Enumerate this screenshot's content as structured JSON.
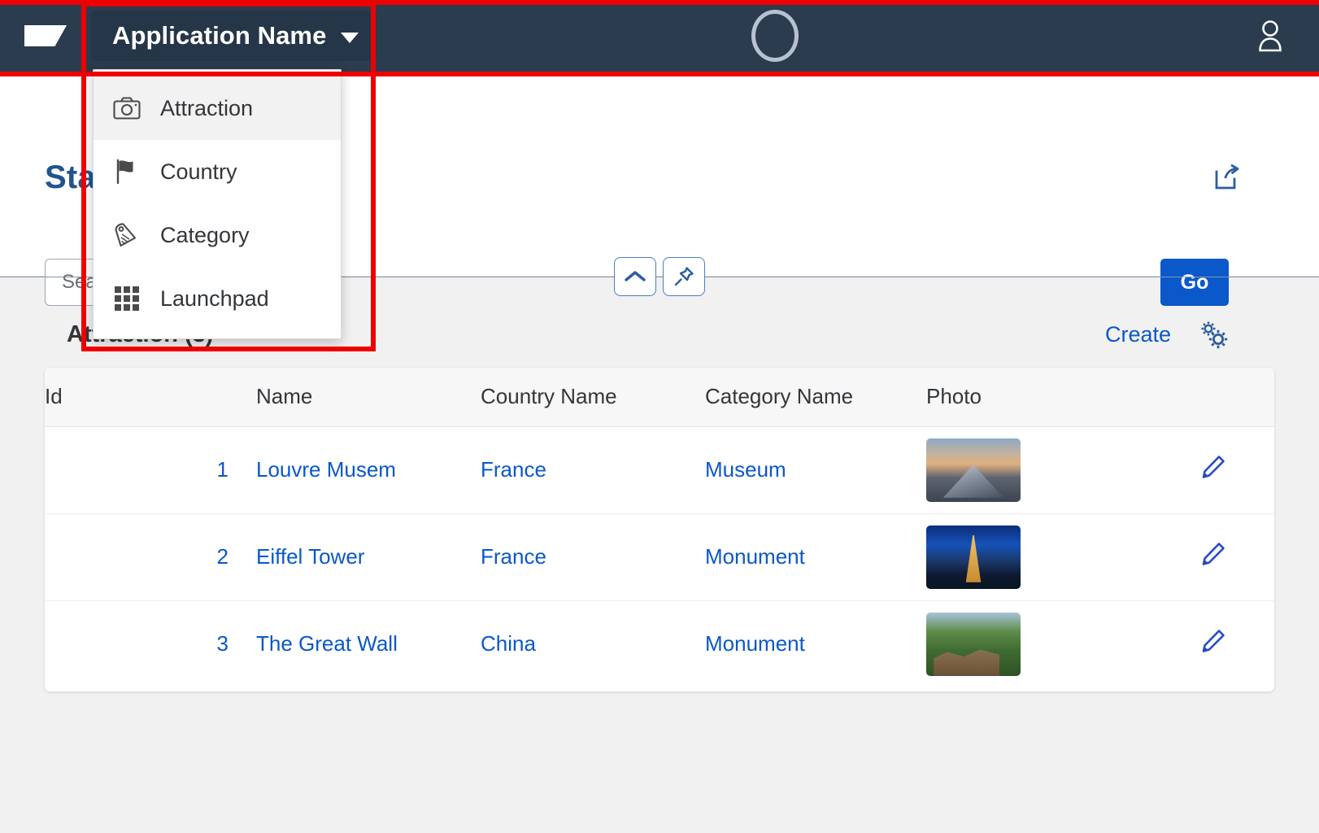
{
  "shell": {
    "logo_icon": "app-logo-shape",
    "app_title": "Application Name",
    "caret_icon": "chevron-down-icon",
    "center_logo_icon": "ring-logo-icon",
    "avatar_icon": "user-avatar-icon",
    "background_color": "#2a3c4e"
  },
  "menu": {
    "items": [
      {
        "label": "Attraction",
        "icon": "camera-icon",
        "selected": true
      },
      {
        "label": "Country",
        "icon": "flag-icon",
        "selected": false
      },
      {
        "label": "Category",
        "icon": "tag-icon",
        "selected": false
      },
      {
        "label": "Launchpad",
        "icon": "grid-icon",
        "selected": false
      }
    ]
  },
  "page": {
    "title": "Sta",
    "title_color": "#20548f",
    "share_icon": "share-export-icon",
    "collapse_icon": "chevron-up-icon",
    "pin_icon": "pin-icon"
  },
  "filter_bar": {
    "search": {
      "value": "",
      "placeholder": "Search"
    },
    "go_label": "Go",
    "go_color": "#0a58ca"
  },
  "table": {
    "heading": "Attraction (3)",
    "create_label": "Create",
    "settings_icon": "gear-settings-icon",
    "columns": [
      "Id",
      "Name",
      "Country Name",
      "Category Name",
      "Photo",
      ""
    ],
    "rows": [
      {
        "id": "1",
        "name": "Louvre Musem",
        "country": "France",
        "category": "Museum",
        "photo": "louvre-thumbnail",
        "edit_icon": "edit-pencil-icon"
      },
      {
        "id": "2",
        "name": "Eiffel Tower",
        "country": "France",
        "category": "Monument",
        "photo": "eiffel-tower-thumbnail",
        "edit_icon": "edit-pencil-icon"
      },
      {
        "id": "3",
        "name": "The Great Wall",
        "country": "China",
        "category": "Monument",
        "photo": "great-wall-thumbnail",
        "edit_icon": "edit-pencil-icon"
      }
    ],
    "link_color": "#0a58ca"
  },
  "annotations": {
    "highlight_color": "#ee0000",
    "boxes": [
      "shell-header-region",
      "app-menu-region"
    ]
  }
}
